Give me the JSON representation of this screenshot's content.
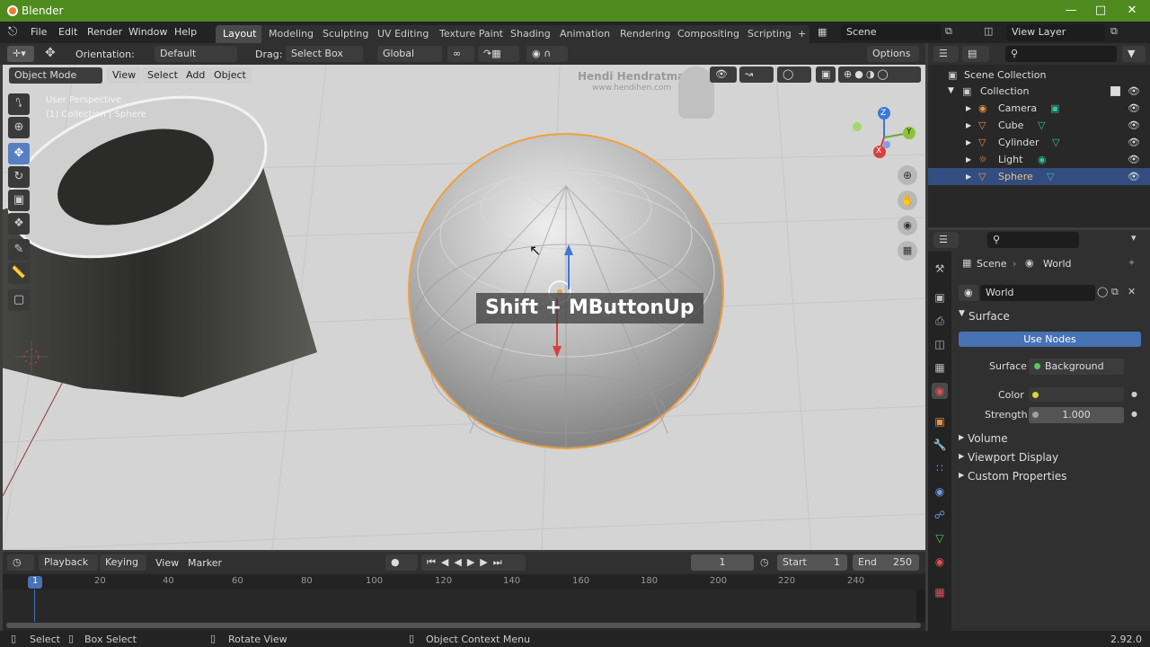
{
  "window": {
    "title": "Blender"
  },
  "menu": [
    "File",
    "Edit",
    "Render",
    "Window",
    "Help"
  ],
  "workspaces": [
    "Layout",
    "Modeling",
    "Sculpting",
    "UV Editing",
    "Texture Paint",
    "Shading",
    "Animation",
    "Rendering",
    "Compositing",
    "Scripting"
  ],
  "scene": "Scene",
  "view_layer": "View Layer",
  "toolheader": {
    "orientation_label": "Orientation:",
    "orientation": "Default",
    "drag_label": "Drag:",
    "drag": "Select Box",
    "transform": "Global",
    "options": "Options"
  },
  "viewport": {
    "mode": "Object Mode",
    "menus": [
      "View",
      "Select",
      "Add",
      "Object"
    ],
    "info_line1": "User Perspective",
    "info_line2": "(1) Collection | Sphere",
    "watermark_name": "Hendi Hendratman",
    "watermark_url": "www.hendihen.com",
    "overlay": "Shift + MButtonUp",
    "gizmo_axes": {
      "x": "X",
      "y": "Y",
      "z": "Z"
    }
  },
  "outliner": {
    "root": "Scene Collection",
    "collection": "Collection",
    "objects": [
      "Camera",
      "Cube",
      "Cylinder",
      "Light",
      "Sphere"
    ],
    "selected": "Sphere"
  },
  "properties": {
    "breadcrumb_scene": "Scene",
    "breadcrumb_world": "World",
    "world_name": "World",
    "surface_panel": "Surface",
    "use_nodes": "Use Nodes",
    "surface_label": "Surface",
    "surface_value": "Background",
    "color_label": "Color",
    "strength_label": "Strength",
    "strength_value": "1.000",
    "panels": [
      "Volume",
      "Viewport Display",
      "Custom Properties"
    ]
  },
  "timeline": {
    "menus": [
      "Playback",
      "Keying",
      "View",
      "Marker"
    ],
    "current_frame": "1",
    "start_label": "Start",
    "start": "1",
    "end_label": "End",
    "end": "250",
    "ticks": [
      "1",
      "20",
      "40",
      "60",
      "80",
      "100",
      "120",
      "140",
      "160",
      "180",
      "200",
      "220",
      "240"
    ]
  },
  "status": {
    "select": "Select",
    "box_select": "Box Select",
    "rotate_view": "Rotate View",
    "context_menu": "Object Context Menu",
    "version": "2.92.0"
  },
  "colors": {
    "accent": "#5680c2",
    "title": "#4f8a1f",
    "selection": "#f0a040"
  }
}
